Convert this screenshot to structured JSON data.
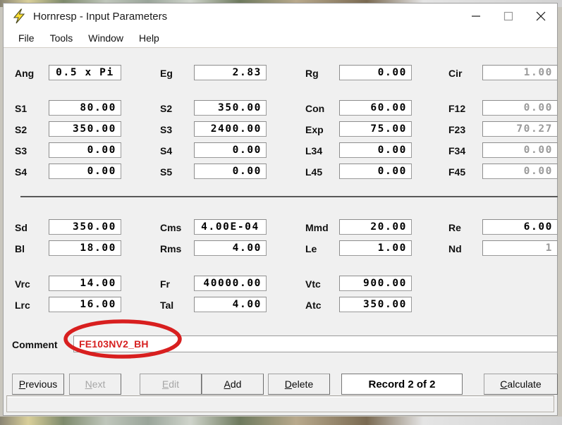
{
  "window": {
    "title": "Hornresp - Input Parameters",
    "icon": "lightning-bolt-icon",
    "minimize_label": "Minimize",
    "maximize_label": "Maximize",
    "close_label": "Close"
  },
  "menu": {
    "items": [
      {
        "label": "File"
      },
      {
        "label": "Tools"
      },
      {
        "label": "Window"
      },
      {
        "label": "Help"
      }
    ]
  },
  "parameters": {
    "rows": [
      {
        "cells": [
          {
            "label": "Ang",
            "value": "0.5 x Pi",
            "disabled": false,
            "align": "center"
          },
          {
            "label": "Eg",
            "value": "2.83",
            "disabled": false,
            "align": "right"
          },
          {
            "label": "Rg",
            "value": "0.00",
            "disabled": false,
            "align": "right"
          },
          {
            "label": "Cir",
            "value": "1.00",
            "disabled": true,
            "align": "right"
          }
        ]
      },
      {
        "cells": [
          {
            "label": "S1",
            "value": "80.00",
            "disabled": false,
            "align": "right"
          },
          {
            "label": "S2",
            "value": "350.00",
            "disabled": false,
            "align": "right"
          },
          {
            "label": "Con",
            "value": "60.00",
            "disabled": false,
            "align": "right"
          },
          {
            "label": "F12",
            "value": "0.00",
            "disabled": true,
            "align": "right"
          }
        ]
      },
      {
        "cells": [
          {
            "label": "S2",
            "value": "350.00",
            "disabled": false,
            "align": "right"
          },
          {
            "label": "S3",
            "value": "2400.00",
            "disabled": false,
            "align": "right"
          },
          {
            "label": "Exp",
            "value": "75.00",
            "disabled": false,
            "align": "right"
          },
          {
            "label": "F23",
            "value": "70.27",
            "disabled": true,
            "align": "right"
          }
        ]
      },
      {
        "cells": [
          {
            "label": "S3",
            "value": "0.00",
            "disabled": false,
            "align": "right"
          },
          {
            "label": "S4",
            "value": "0.00",
            "disabled": false,
            "align": "right"
          },
          {
            "label": "L34",
            "value": "0.00",
            "disabled": false,
            "align": "right"
          },
          {
            "label": "F34",
            "value": "0.00",
            "disabled": true,
            "align": "right"
          }
        ]
      },
      {
        "cells": [
          {
            "label": "S4",
            "value": "0.00",
            "disabled": false,
            "align": "right"
          },
          {
            "label": "S5",
            "value": "0.00",
            "disabled": false,
            "align": "right"
          },
          {
            "label": "L45",
            "value": "0.00",
            "disabled": false,
            "align": "right"
          },
          {
            "label": "F45",
            "value": "0.00",
            "disabled": true,
            "align": "right"
          }
        ]
      },
      {
        "cells": [
          {
            "label": "Sd",
            "value": "350.00",
            "disabled": false,
            "align": "right"
          },
          {
            "label": "Cms",
            "value": "4.00E-04",
            "disabled": false,
            "align": "center"
          },
          {
            "label": "Mmd",
            "value": "20.00",
            "disabled": false,
            "align": "right"
          },
          {
            "label": "Re",
            "value": "6.00",
            "disabled": false,
            "align": "right"
          }
        ]
      },
      {
        "cells": [
          {
            "label": "Bl",
            "value": "18.00",
            "disabled": false,
            "align": "right"
          },
          {
            "label": "Rms",
            "value": "4.00",
            "disabled": false,
            "align": "right"
          },
          {
            "label": "Le",
            "value": "1.00",
            "disabled": false,
            "align": "right"
          },
          {
            "label": "Nd",
            "value": "1",
            "disabled": true,
            "align": "right"
          }
        ]
      },
      {
        "cells": [
          {
            "label": "Vrc",
            "value": "14.00",
            "disabled": false,
            "align": "right"
          },
          {
            "label": "Fr",
            "value": "40000.00",
            "disabled": false,
            "align": "right"
          },
          {
            "label": "Vtc",
            "value": "900.00",
            "disabled": false,
            "align": "right"
          }
        ]
      },
      {
        "cells": [
          {
            "label": "Lrc",
            "value": "16.00",
            "disabled": false,
            "align": "right"
          },
          {
            "label": "Tal",
            "value": "4.00",
            "disabled": false,
            "align": "right"
          },
          {
            "label": "Atc",
            "value": "350.00",
            "disabled": false,
            "align": "right"
          }
        ]
      }
    ]
  },
  "comment": {
    "label": "Comment",
    "value": "FE103NV2_BH",
    "placeholder": "",
    "text_color": "#d62020"
  },
  "annotation": {
    "shape": "red-ellipse-highlight",
    "color": "#d81f1f"
  },
  "buttons": {
    "previous": {
      "label": "Previous",
      "accel": "P",
      "disabled": false
    },
    "next": {
      "label": "Next",
      "accel": "N",
      "disabled": true
    },
    "edit": {
      "label": "Edit",
      "accel": "E",
      "disabled": true
    },
    "add": {
      "label": "Add",
      "accel": "A",
      "disabled": false
    },
    "delete": {
      "label": "Delete",
      "accel": "D",
      "disabled": false
    },
    "calculate": {
      "label": "Calculate",
      "accel": "C",
      "disabled": false
    }
  },
  "record_display": {
    "text": "Record 2 of 2"
  },
  "statusbar": {
    "text": ""
  }
}
